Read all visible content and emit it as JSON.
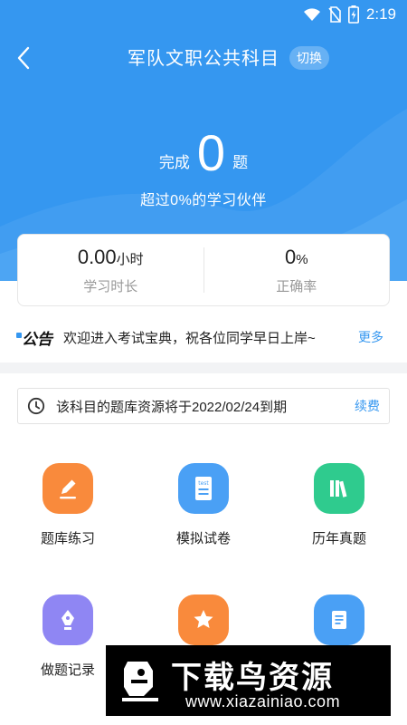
{
  "status_bar": {
    "time": "2:19",
    "icons": [
      "wifi-icon",
      "no-sim-icon",
      "battery-charging-icon"
    ]
  },
  "header": {
    "title": "军队文职公共科目",
    "switch_label": "切换",
    "back_icon": "chevron-left-icon"
  },
  "progress": {
    "prefix": "完成",
    "count": "0",
    "suffix": "题",
    "beat_text": "超过0%的学习伙伴"
  },
  "stats": [
    {
      "value": "0.00",
      "unit": "小时",
      "label": "学习时长"
    },
    {
      "value": "0",
      "unit": "%",
      "label": "正确率"
    }
  ],
  "notice": {
    "tag": "公告",
    "text": "欢迎进入考试宝典，祝各位同学早日上岸~",
    "more": "更多"
  },
  "expiry": {
    "text": "该科目的题库资源将于2022/02/24到期",
    "renew": "续费",
    "icon": "clock-icon"
  },
  "menu": [
    {
      "label": "题库练习",
      "icon": "pencil-icon",
      "color": "#f98a3c"
    },
    {
      "label": "模拟试卷",
      "icon": "test-paper-icon",
      "color": "#4aa0f5"
    },
    {
      "label": "历年真题",
      "icon": "books-icon",
      "color": "#2fcb8e"
    },
    {
      "label": "做题记录",
      "icon": "pen-nib-icon",
      "color": "#8f86f3"
    },
    {
      "label": "",
      "icon": "star-icon",
      "color": "#f98a3c"
    },
    {
      "label": "",
      "icon": "document-icon",
      "color": "#4aa0f5"
    }
  ],
  "watermark": {
    "title": "下载鸟资源",
    "url": "www.xiazainiao.com"
  }
}
